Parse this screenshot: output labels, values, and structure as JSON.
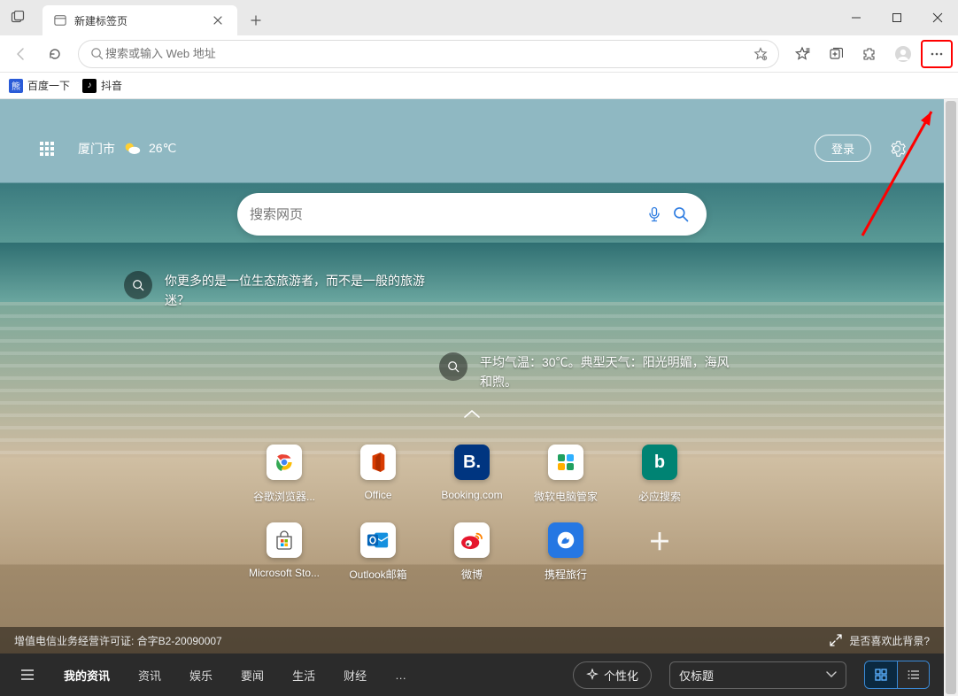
{
  "tab": {
    "title": "新建标签页"
  },
  "addressBar": {
    "placeholder": "搜索或输入 Web 地址"
  },
  "favorites": [
    {
      "label": "百度一下",
      "icon_bg": "#2a5bd7",
      "icon_text": "熊"
    },
    {
      "label": "抖音",
      "icon_bg": "#000000",
      "icon_text": "♪"
    }
  ],
  "ntp": {
    "city": "厦门市",
    "temp": "26℃",
    "login": "登录",
    "search_placeholder": "搜索网页",
    "promo1": "你更多的是一位生态旅游者，而不是一般的旅游迷？",
    "promo2": "平均气温：30℃。典型天气：阳光明媚，海风和煦。",
    "tiles": [
      {
        "label": "谷歌浏览器...",
        "bg": "#ffffff",
        "fg": "#333"
      },
      {
        "label": "Office",
        "bg": "#ffffff",
        "fg": "#d83b01"
      },
      {
        "label": "Booking.com",
        "bg": "#003580",
        "fg": "#ffffff",
        "text": "B."
      },
      {
        "label": "微软电脑管家",
        "bg": "#ffffff",
        "fg": "#20a060"
      },
      {
        "label": "必应搜索",
        "bg": "#008373",
        "fg": "#ffffff",
        "text": "b"
      },
      {
        "label": "Microsoft Sto...",
        "bg": "#ffffff",
        "fg": "#333"
      },
      {
        "label": "Outlook邮箱",
        "bg": "#ffffff",
        "fg": "#0078d4"
      },
      {
        "label": "微博",
        "bg": "#ffffff",
        "fg": "#e6162d"
      },
      {
        "label": "携程旅行",
        "bg": "#2577e3",
        "fg": "#ffffff"
      }
    ],
    "disclaimer": "增值电信业务经营许可证: 合字B2-20090007",
    "bg_question": "是否喜欢此背景?"
  },
  "bottomNav": {
    "menu_icon": "☰",
    "cats": [
      "我的资讯",
      "资讯",
      "娱乐",
      "要闻",
      "生活",
      "财经"
    ],
    "more": "…",
    "personalize": "个性化",
    "layout_select": "仅标题"
  }
}
